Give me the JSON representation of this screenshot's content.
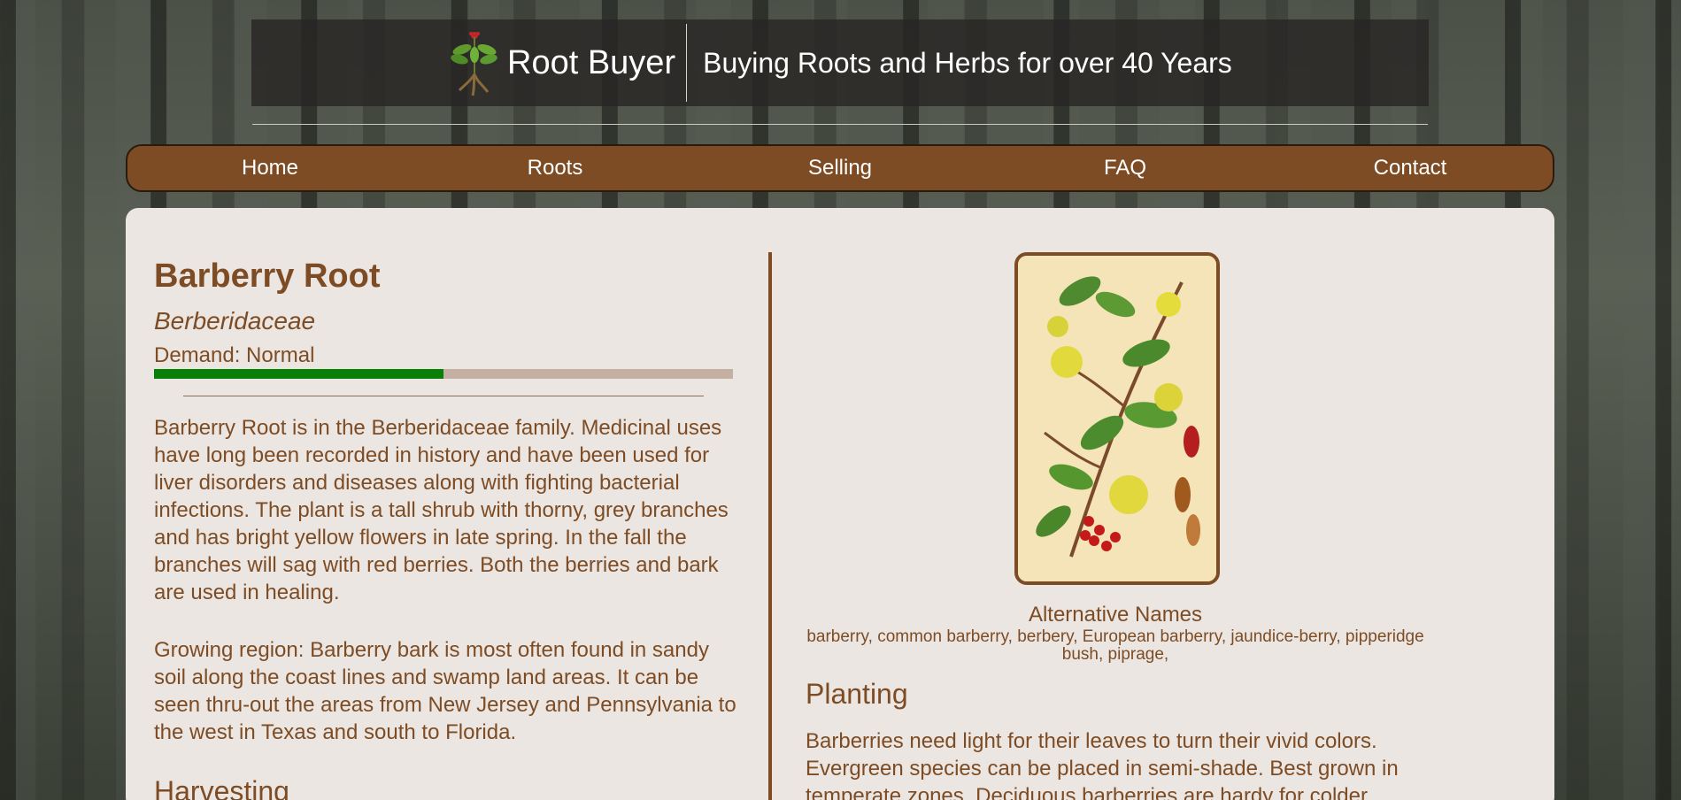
{
  "header": {
    "site_name": "Root Buyer",
    "tagline": "Buying Roots and Herbs for over 40 Years",
    "logo_icon": "ginseng-plant-icon"
  },
  "nav": {
    "items": [
      {
        "label": "Home"
      },
      {
        "label": "Roots"
      },
      {
        "label": "Selling"
      },
      {
        "label": "FAQ"
      },
      {
        "label": "Contact"
      }
    ]
  },
  "root": {
    "title": "Barberry Root",
    "family": "Berberidaceae",
    "demand_label": "Demand: Normal",
    "demand_level": 0.5,
    "colors": {
      "brand_brown": "#7d4c24",
      "demand_fill": "#088008",
      "demand_track": "#c4b0a2"
    },
    "description": "Barberry Root is in the Berberidaceae family. Medicinal uses have long been recorded in history and have been used for liver disorders and diseases along with fighting bacterial infections. The plant is a tall shrub with thorny, grey branches and has bright yellow flowers in late spring. In the fall the branches will sag with red berries. Both the berries and bark are used in healing.",
    "growing_region": "Growing region: Barberry bark is most often found in sandy soil along the coast lines and swamp land areas. It can be seen thru-out the areas from New Jersey and Pennsylvania to the west in Texas and south to Florida.",
    "harvesting_heading": "Harvesting",
    "alt_names_title": "Alternative Names",
    "alt_names": "barberry, common barberry, berbery, European barberry, jaundice-berry, pipperidge bush, piprage,",
    "planting_heading": "Planting",
    "planting_text": "Barberries need light for their leaves to turn their vivid colors. Evergreen species can be placed in semi-shade. Best grown in temperate zones. Deciduous barberries are hardy for colder"
  }
}
